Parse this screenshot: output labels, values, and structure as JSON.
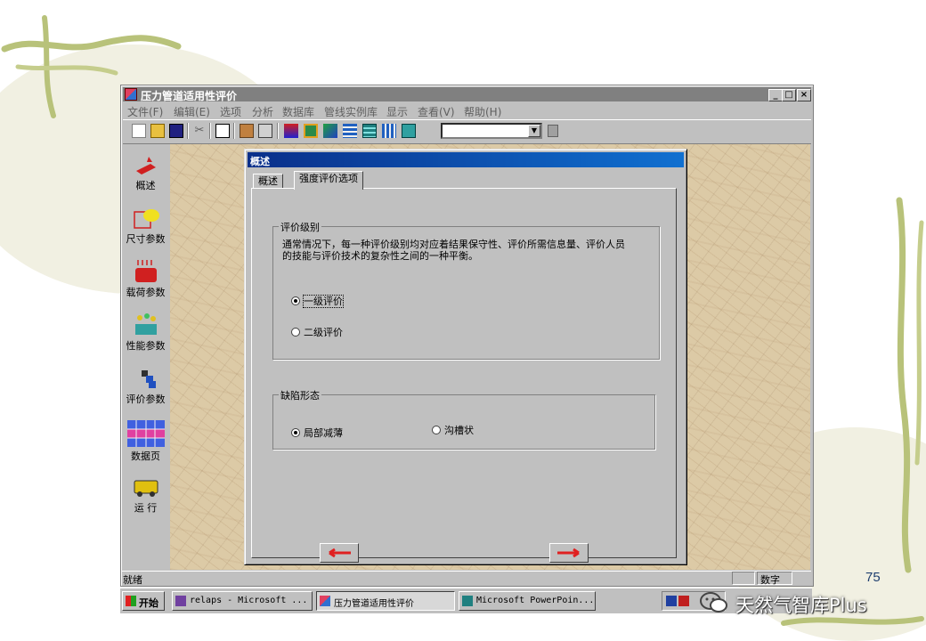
{
  "slide": {
    "number": "75"
  },
  "app": {
    "title": "压力管道适用性评价",
    "controls": {
      "minimize": "_",
      "maximize": "□",
      "close": "×"
    }
  },
  "menu": [
    "文件(F)",
    "编辑(E)",
    "选项",
    "分析",
    "数据库",
    "管线实例库",
    "显示",
    "查看(V)",
    "帮助(H)"
  ],
  "toolbar": {
    "tools": [
      "new-icon",
      "open-icon",
      "save-icon",
      "cut-icon",
      "copy-icon",
      "paste-icon",
      "print-icon",
      "chart-icon",
      "map-icon",
      "graph-icon",
      "list-icon",
      "table-icon",
      "stack-icon",
      "fit-icon"
    ],
    "combo_value": ""
  },
  "sidebar": [
    {
      "label": "概述",
      "icon": "overview-icon"
    },
    {
      "label": "尺寸参数",
      "icon": "dimension-icon"
    },
    {
      "label": "载荷参数",
      "icon": "load-icon"
    },
    {
      "label": "性能参数",
      "icon": "performance-icon"
    },
    {
      "label": "评价参数",
      "icon": "evaluation-icon"
    },
    {
      "label": "数据页",
      "icon": "data-page-icon"
    },
    {
      "label": "运  行",
      "icon": "run-icon"
    }
  ],
  "dialog": {
    "title": "概述",
    "tabs": [
      {
        "label": "概述",
        "active": false
      },
      {
        "label": "强度评价选项",
        "active": true
      }
    ],
    "level_group": {
      "caption": "评价级别",
      "description": "通常情况下，每一种评价级别均对应着结果保守性、评价所需信息量、评价人员的技能与评价技术的复杂性之间的一种平衡。",
      "options": [
        {
          "label": "一级评价",
          "selected": true
        },
        {
          "label": "二级评价",
          "selected": false
        }
      ]
    },
    "defect_group": {
      "caption": "缺陷形态",
      "options": [
        {
          "label": "局部减薄",
          "selected": true
        },
        {
          "label": "沟槽状",
          "selected": false
        }
      ]
    },
    "nav": {
      "prev": "left-arrow-icon",
      "next": "right-arrow-icon"
    }
  },
  "status": {
    "text": "就绪",
    "mode": "数字"
  },
  "taskbar": {
    "start": "开始",
    "tasks": [
      {
        "label": "relaps - Microsoft ...",
        "active": false
      },
      {
        "label": "压力管道适用性评价",
        "active": true
      },
      {
        "label": "Microsoft PowerPoin...",
        "active": false
      }
    ]
  },
  "watermark": {
    "text": "天然气智库Plus"
  },
  "colors": {
    "title_active": "#0a2f8a",
    "arrow": "#e02020",
    "face": "#c0c0c0",
    "paper": "#dccaa6"
  }
}
